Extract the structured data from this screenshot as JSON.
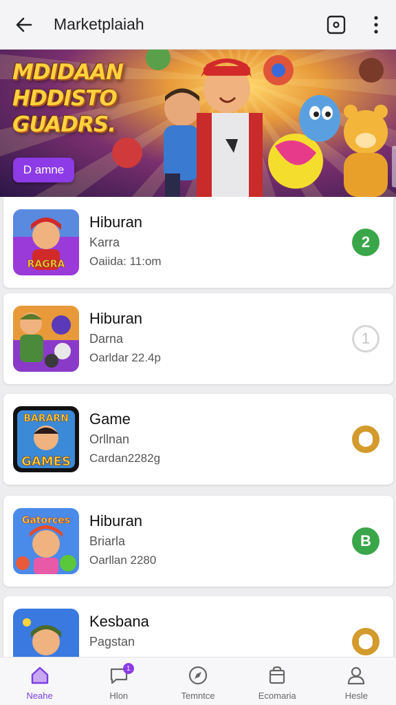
{
  "appbar": {
    "title": "Marketplaiah",
    "back_icon": "arrow-left-icon",
    "action_icon": "square-target-icon",
    "more_icon": "more-vertical-icon"
  },
  "banner": {
    "headline_line1": "MDIDAAN",
    "headline_line2": "HDDISTO",
    "headline_line3": "GUADRS.",
    "cta_label": "D amne"
  },
  "items": [
    {
      "title": "Hiburan",
      "subtitle": "Karra",
      "meta": "Oaiida: 11:om",
      "badge": "2",
      "badge_color": "#3aa64a"
    },
    {
      "title": "Hiburan",
      "subtitle": "Darna",
      "meta": "Oarldar 22.4p",
      "badge": "1",
      "badge_color": "#d6d6d6"
    },
    {
      "title": "Game",
      "subtitle": "Orllnan",
      "meta": "Cardan2282g",
      "badge": "",
      "badge_color": "#d39a2c"
    },
    {
      "title": "Hiburan",
      "subtitle": "Briarla",
      "meta": "Oarllan 2280",
      "badge": "B",
      "badge_color": "#3aa64a"
    },
    {
      "title": "Kesbana",
      "subtitle": "Pagstan",
      "meta": "",
      "badge": "",
      "badge_color": "#d39a2c"
    }
  ],
  "thumbs": [
    {
      "text": "RAGRA"
    },
    {
      "text": ""
    },
    {
      "text_top": "BARARN",
      "text_bottom": "GAMES"
    },
    {
      "text": "Gatorces"
    },
    {
      "text": ""
    }
  ],
  "nav": [
    {
      "label": "Neahe",
      "icon": "home-icon",
      "active": true
    },
    {
      "label": "Hlon",
      "icon": "chat-icon",
      "badge": "1"
    },
    {
      "label": "Temntce",
      "icon": "compass-icon"
    },
    {
      "label": "Ecomaria",
      "icon": "bag-icon"
    },
    {
      "label": "Hesle",
      "icon": "user-icon"
    }
  ],
  "colors": {
    "accent": "#8c3be6",
    "green": "#3aa64a",
    "gold": "#d39a2c"
  }
}
